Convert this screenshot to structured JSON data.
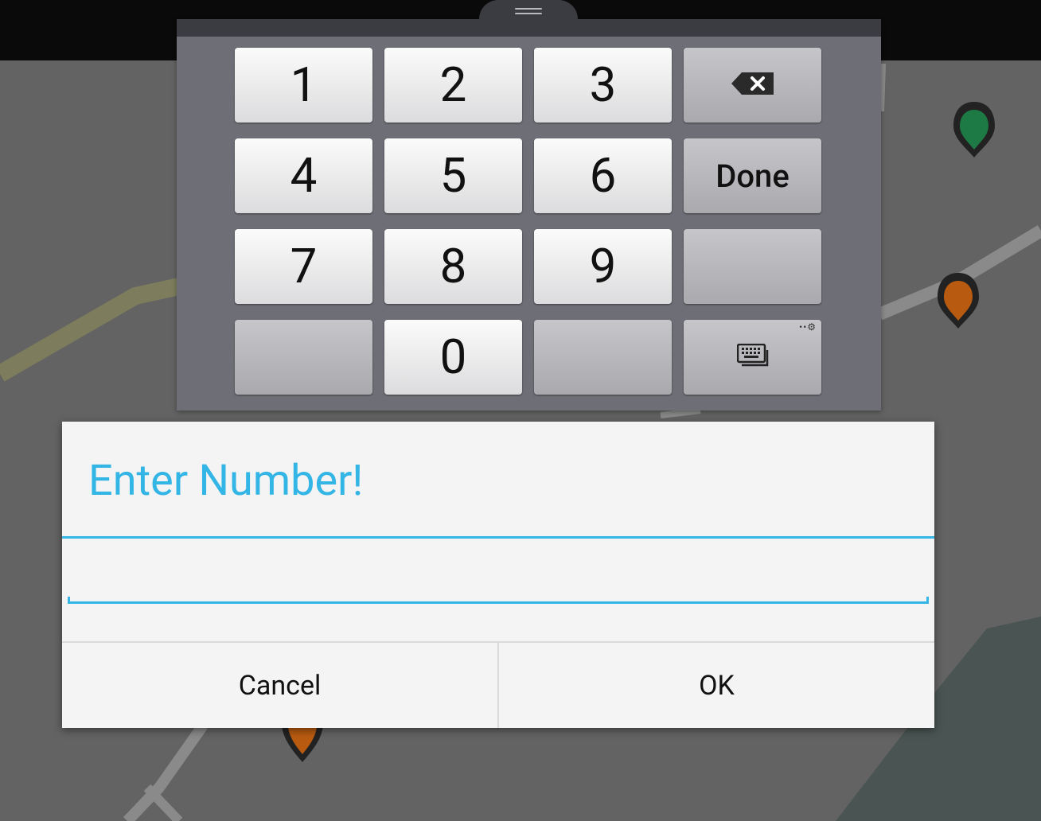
{
  "keypad": {
    "keys": [
      {
        "label": "1",
        "style": "light",
        "row": 0,
        "col": 0,
        "kind": "num"
      },
      {
        "label": "2",
        "style": "light",
        "row": 0,
        "col": 1,
        "kind": "num"
      },
      {
        "label": "3",
        "style": "light",
        "row": 0,
        "col": 2,
        "kind": "num"
      },
      {
        "label": "",
        "style": "dark",
        "row": 0,
        "col": 3,
        "kind": "icon",
        "icon": "backspace-icon"
      },
      {
        "label": "4",
        "style": "light",
        "row": 1,
        "col": 0,
        "kind": "num"
      },
      {
        "label": "5",
        "style": "light",
        "row": 1,
        "col": 1,
        "kind": "num"
      },
      {
        "label": "6",
        "style": "light",
        "row": 1,
        "col": 2,
        "kind": "num"
      },
      {
        "label": "Done",
        "style": "dark",
        "row": 1,
        "col": 3,
        "kind": "done"
      },
      {
        "label": "7",
        "style": "light",
        "row": 2,
        "col": 0,
        "kind": "num"
      },
      {
        "label": "8",
        "style": "light",
        "row": 2,
        "col": 1,
        "kind": "num"
      },
      {
        "label": "9",
        "style": "light",
        "row": 2,
        "col": 2,
        "kind": "num"
      },
      {
        "label": "",
        "style": "dark",
        "row": 2,
        "col": 3,
        "kind": "blank"
      },
      {
        "label": "",
        "style": "dark",
        "row": 3,
        "col": 0,
        "kind": "blank"
      },
      {
        "label": "0",
        "style": "light",
        "row": 3,
        "col": 1,
        "kind": "num"
      },
      {
        "label": "",
        "style": "dark",
        "row": 3,
        "col": 2,
        "kind": "blank"
      },
      {
        "label": "",
        "style": "dark",
        "row": 3,
        "col": 3,
        "kind": "icon",
        "icon": "keyboard-settings-icon"
      }
    ]
  },
  "dialog": {
    "title": "Enter Number!",
    "input_value": "",
    "cancel_label": "Cancel",
    "ok_label": "OK"
  },
  "map": {
    "markers": [
      {
        "icon": "map-pin-icon",
        "color": "#1e7a45"
      },
      {
        "icon": "map-pin-icon",
        "color": "#b85b10"
      },
      {
        "icon": "map-pin-icon",
        "color": "#b85b10"
      }
    ]
  },
  "colors": {
    "accent": "#33b5e5",
    "keypad_bg": "#6e6e76",
    "dialog_bg": "#f4f4f4"
  }
}
